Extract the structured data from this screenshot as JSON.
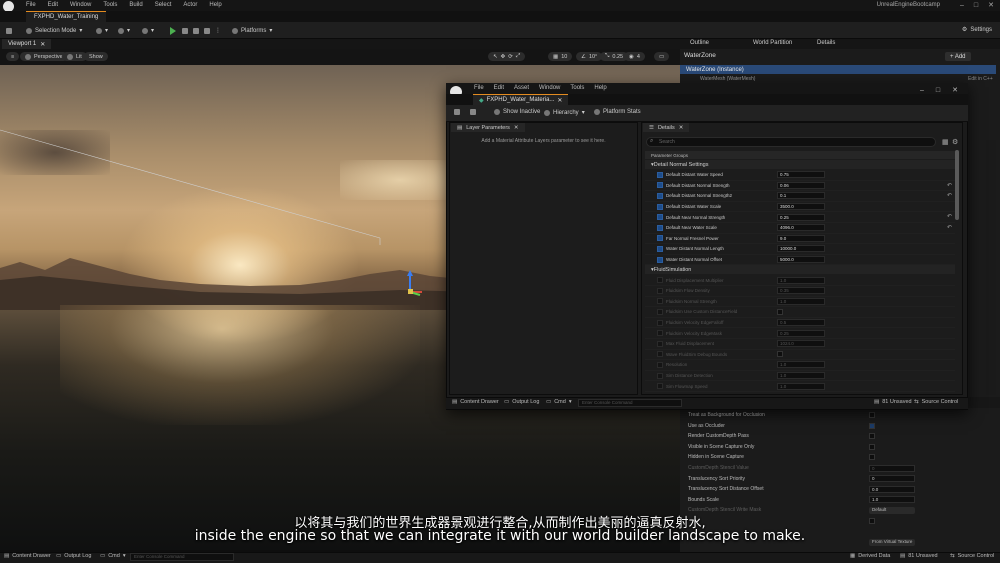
{
  "app": {
    "menu": [
      "File",
      "Edit",
      "Window",
      "Tools",
      "Build",
      "Select",
      "Actor",
      "Help"
    ],
    "project_tab": "FXPHD_Water_Training",
    "project_name": "UnrealEngineBootcamp"
  },
  "toolbar": {
    "selection_mode": "Selection Mode",
    "platforms": "Platforms",
    "settings": "Settings"
  },
  "viewport": {
    "tab": "Viewport 1",
    "perspective": "Perspective",
    "lit": "Lit",
    "show": "Show",
    "snap_values": [
      "10",
      "10°",
      "0.25",
      "4"
    ]
  },
  "outliner": {
    "tabs": [
      "Outline",
      "World Partition",
      "Details"
    ],
    "actor": "WaterZone",
    "add_label": "+ Add",
    "instance": "WaterZone (Instance)",
    "component": "WaterMesh (WaterMesh)",
    "edit_cpp": "Edit in C++"
  },
  "material_editor": {
    "menu": [
      "File",
      "Edit",
      "Asset",
      "Window",
      "Tools",
      "Help"
    ],
    "tab": "FXPHD_Water_Materia...",
    "toolbar": {
      "show_inactive": "Show Inactive",
      "hierarchy": "Hierarchy",
      "platform_stats": "Platform Stats"
    },
    "layer_panel": {
      "tab": "Layer Parameters",
      "message": "Add a Material Attribute Layers parameter to see it here."
    },
    "details": {
      "tab": "Details",
      "search_placeholder": "Search",
      "parameter_groups": "Parameter Groups",
      "groups": [
        {
          "name": "Detail Normal Settings",
          "params": [
            {
              "label": "Default Distant Water Speed",
              "value": "0.75"
            },
            {
              "label": "Default Distant Normal Strength",
              "value": "0.06"
            },
            {
              "label": "Default Distant Normal Strength2",
              "value": "0.1"
            },
            {
              "label": "Default Distant Water Scale",
              "value": "3500.0"
            },
            {
              "label": "Default Near Normal Strength",
              "value": "0.25"
            },
            {
              "label": "Default Near Water Scale",
              "value": "4096.0"
            },
            {
              "label": "Far Normal Fresnel Power",
              "value": "9.0"
            },
            {
              "label": "Water Distant Normal Length",
              "value": "10000.0"
            },
            {
              "label": "Water Distant Normal Offset",
              "value": "5000.0"
            }
          ]
        },
        {
          "name": "FluidSimulation",
          "params": [
            {
              "label": "Fluid Displacement Multiplier",
              "value": "1.0"
            },
            {
              "label": "Fluidsim Flow Density",
              "value": "0.35"
            },
            {
              "label": "Fluidsim Normal Strength",
              "value": "1.0"
            },
            {
              "label": "Fluidsim Use Custom DistanceField",
              "value": ""
            },
            {
              "label": "Fluidsim Velocity EdgeFalloff",
              "value": "0.5"
            },
            {
              "label": "Fluidsim Velocity EdgeMask",
              "value": "0.25"
            },
            {
              "label": "Max Fluid Displacement",
              "value": "1024.0"
            },
            {
              "label": "Wave FluidSim Debug Bounds",
              "value": ""
            },
            {
              "label": "Resolution",
              "value": "1.0"
            },
            {
              "label": "Sim Distance Detection",
              "value": "1.0"
            },
            {
              "label": "Sim Flowmap Speed",
              "value": "1.0"
            }
          ]
        }
      ]
    },
    "bottom": {
      "content_drawer": "Content Drawer",
      "output_log": "Output Log",
      "cmd": "Cmd",
      "console_placeholder": "Enter Console Command",
      "unsaved": "81 Unsaved",
      "source_control": "Source Control"
    }
  },
  "right_details": {
    "rows": [
      {
        "label": "Treat as Background for Occlusion",
        "type": "check",
        "checked": false
      },
      {
        "label": "Use as Occluder",
        "type": "check",
        "checked": true
      },
      {
        "label": "Render CustomDepth Pass",
        "type": "check",
        "checked": false
      },
      {
        "label": "Visible in Scene Capture Only",
        "type": "check",
        "checked": false
      },
      {
        "label": "Hidden in Scene Capture",
        "type": "check",
        "checked": false
      },
      {
        "label": "CustomDepth Stencil Value",
        "type": "num",
        "value": "0",
        "dim": true
      },
      {
        "label": "Translucency Sort Priority",
        "type": "num",
        "value": "0"
      },
      {
        "label": "Translucency Sort Distance Offset",
        "type": "num",
        "value": "0.0"
      },
      {
        "label": "Bounds Scale",
        "type": "num",
        "value": "1.0"
      },
      {
        "label": "CustomDepth Stencil Write Mask",
        "type": "drop",
        "value": "Default",
        "dim": true
      },
      {
        "label": "",
        "type": "check",
        "checked": false
      },
      {
        "label": "",
        "type": "blank"
      },
      {
        "label": "",
        "type": "drop",
        "value": "From Virtual Texture"
      }
    ]
  },
  "status": {
    "content_drawer": "Content Drawer",
    "output_log": "Output Log",
    "cmd": "Cmd",
    "console_placeholder": "Enter Console Command",
    "derived_data": "Derived Data",
    "unsaved": "81 Unsaved",
    "source_control": "Source Control"
  },
  "subtitles": {
    "chinese": "以将其与我们的世界生成器景观进行整合,从而制作出美丽的逼真反射水,",
    "english": "inside the engine so that we can integrate it with our world builder landscape to make."
  }
}
